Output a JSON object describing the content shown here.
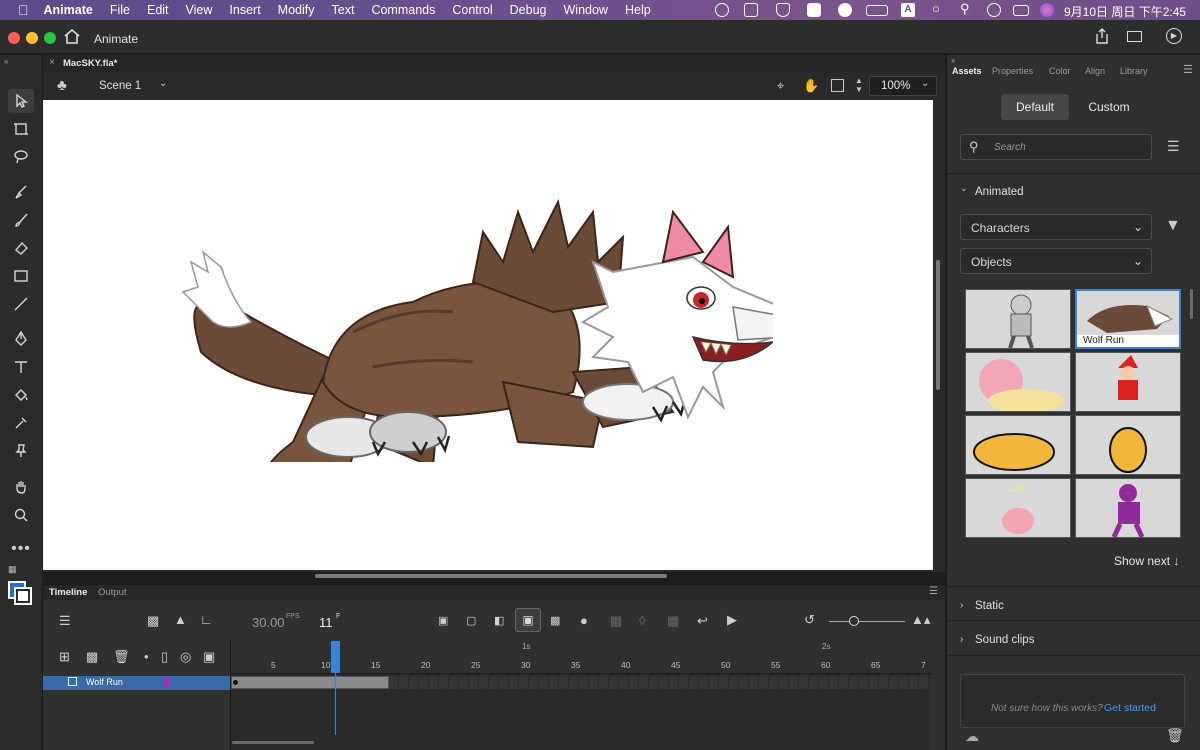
{
  "menubar": {
    "app_name": "Animate",
    "items": [
      "File",
      "Edit",
      "View",
      "Insert",
      "Modify",
      "Text",
      "Commands",
      "Control",
      "Debug",
      "Window",
      "Help"
    ],
    "clock": "9月10日 周日 下午2:45",
    "keyboard_label": "A"
  },
  "titlebar": {
    "home_label": "Animate"
  },
  "document": {
    "tab_label": "MacSKY.fla*",
    "scene_label": "Scene 1",
    "zoom": "100%"
  },
  "timeline": {
    "tabs": [
      "Timeline",
      "Output"
    ],
    "fps_value": "30.00",
    "fps_unit": "FPS",
    "frame_value": "11",
    "frame_unit": "F",
    "seconds_marks": [
      "1s",
      "2s"
    ],
    "frame_ticks": [
      "5",
      "10",
      "15",
      "20",
      "25",
      "30",
      "35",
      "40",
      "45",
      "50",
      "55",
      "60",
      "65",
      "7"
    ],
    "layer_name": "Wolf Run",
    "layer_color": "#a62fb5",
    "accent": "#3b82d9"
  },
  "assets_panel": {
    "tabs": [
      "Assets",
      "Properties",
      "Color",
      "Align",
      "Library"
    ],
    "toggle": {
      "default_label": "Default",
      "custom_label": "Custom"
    },
    "search_placeholder": "Search",
    "animated_label": "Animated",
    "category_select": "Characters",
    "subcategory_select": "Objects",
    "selected_thumb_label": "Wolf Run",
    "show_next_label": "Show next ↓",
    "static_label": "Static",
    "sound_clips_label": "Sound clips",
    "help_text": "Not sure how this works?",
    "help_link": "Get started"
  }
}
